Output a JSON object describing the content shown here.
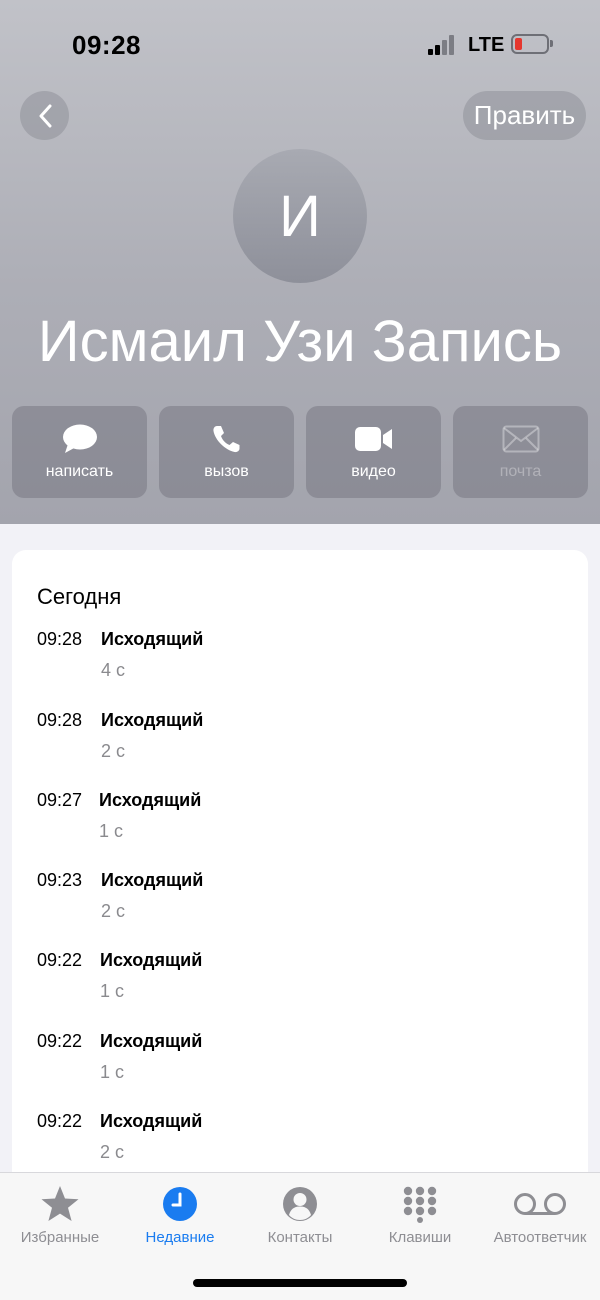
{
  "status_bar": {
    "time": "09:28",
    "network": "LTE"
  },
  "nav": {
    "edit_label": "Править"
  },
  "contact": {
    "initial": "И",
    "name": "Исмаил Узи Запись"
  },
  "actions": [
    {
      "label": "написать",
      "icon": "message-bubble-icon"
    },
    {
      "label": "вызов",
      "icon": "phone-icon"
    },
    {
      "label": "видео",
      "icon": "video-camera-icon"
    },
    {
      "label": "почта",
      "icon": "envelope-icon"
    }
  ],
  "recents": {
    "section_title": "Сегодня",
    "calls": [
      {
        "time": "09:28",
        "type": "Исходящий",
        "duration": "4 с"
      },
      {
        "time": "09:28",
        "type": "Исходящий",
        "duration": "2 с"
      },
      {
        "time": "09:27",
        "type": "Исходящий",
        "duration": "1 с"
      },
      {
        "time": "09:23",
        "type": "Исходящий",
        "duration": "2 с"
      },
      {
        "time": "09:22",
        "type": "Исходящий",
        "duration": "1 с"
      },
      {
        "time": "09:22",
        "type": "Исходящий",
        "duration": "1 с"
      },
      {
        "time": "09:22",
        "type": "Исходящий",
        "duration": "2 с"
      }
    ]
  },
  "tabs": [
    {
      "label": "Избранные",
      "icon": "star-icon"
    },
    {
      "label": "Недавние",
      "icon": "clock-icon",
      "active": true
    },
    {
      "label": "Контакты",
      "icon": "person-circle-icon"
    },
    {
      "label": "Клавиши",
      "icon": "keypad-icon"
    },
    {
      "label": "Автоответчик",
      "icon": "voicemail-icon"
    }
  ],
  "colors": {
    "accent": "#1a7cf0",
    "battery_low": "#e5372f",
    "secondary_text": "#8a8a8e"
  }
}
